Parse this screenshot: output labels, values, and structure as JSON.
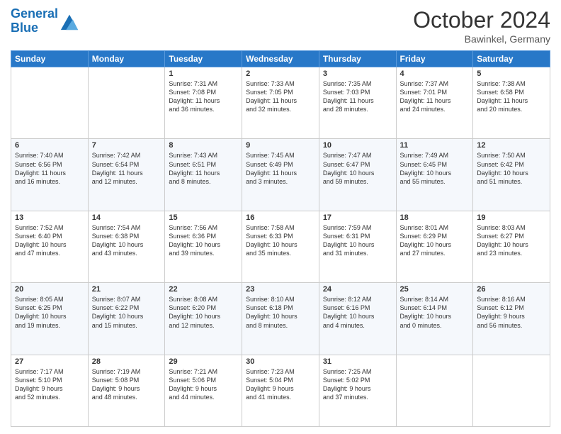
{
  "header": {
    "logo_line1": "General",
    "logo_line2": "Blue",
    "month_title": "October 2024",
    "location": "Bawinkel, Germany"
  },
  "weekdays": [
    "Sunday",
    "Monday",
    "Tuesday",
    "Wednesday",
    "Thursday",
    "Friday",
    "Saturday"
  ],
  "weeks": [
    [
      {
        "day": "",
        "info": ""
      },
      {
        "day": "",
        "info": ""
      },
      {
        "day": "1",
        "info": "Sunrise: 7:31 AM\nSunset: 7:08 PM\nDaylight: 11 hours\nand 36 minutes."
      },
      {
        "day": "2",
        "info": "Sunrise: 7:33 AM\nSunset: 7:05 PM\nDaylight: 11 hours\nand 32 minutes."
      },
      {
        "day": "3",
        "info": "Sunrise: 7:35 AM\nSunset: 7:03 PM\nDaylight: 11 hours\nand 28 minutes."
      },
      {
        "day": "4",
        "info": "Sunrise: 7:37 AM\nSunset: 7:01 PM\nDaylight: 11 hours\nand 24 minutes."
      },
      {
        "day": "5",
        "info": "Sunrise: 7:38 AM\nSunset: 6:58 PM\nDaylight: 11 hours\nand 20 minutes."
      }
    ],
    [
      {
        "day": "6",
        "info": "Sunrise: 7:40 AM\nSunset: 6:56 PM\nDaylight: 11 hours\nand 16 minutes."
      },
      {
        "day": "7",
        "info": "Sunrise: 7:42 AM\nSunset: 6:54 PM\nDaylight: 11 hours\nand 12 minutes."
      },
      {
        "day": "8",
        "info": "Sunrise: 7:43 AM\nSunset: 6:51 PM\nDaylight: 11 hours\nand 8 minutes."
      },
      {
        "day": "9",
        "info": "Sunrise: 7:45 AM\nSunset: 6:49 PM\nDaylight: 11 hours\nand 3 minutes."
      },
      {
        "day": "10",
        "info": "Sunrise: 7:47 AM\nSunset: 6:47 PM\nDaylight: 10 hours\nand 59 minutes."
      },
      {
        "day": "11",
        "info": "Sunrise: 7:49 AM\nSunset: 6:45 PM\nDaylight: 10 hours\nand 55 minutes."
      },
      {
        "day": "12",
        "info": "Sunrise: 7:50 AM\nSunset: 6:42 PM\nDaylight: 10 hours\nand 51 minutes."
      }
    ],
    [
      {
        "day": "13",
        "info": "Sunrise: 7:52 AM\nSunset: 6:40 PM\nDaylight: 10 hours\nand 47 minutes."
      },
      {
        "day": "14",
        "info": "Sunrise: 7:54 AM\nSunset: 6:38 PM\nDaylight: 10 hours\nand 43 minutes."
      },
      {
        "day": "15",
        "info": "Sunrise: 7:56 AM\nSunset: 6:36 PM\nDaylight: 10 hours\nand 39 minutes."
      },
      {
        "day": "16",
        "info": "Sunrise: 7:58 AM\nSunset: 6:33 PM\nDaylight: 10 hours\nand 35 minutes."
      },
      {
        "day": "17",
        "info": "Sunrise: 7:59 AM\nSunset: 6:31 PM\nDaylight: 10 hours\nand 31 minutes."
      },
      {
        "day": "18",
        "info": "Sunrise: 8:01 AM\nSunset: 6:29 PM\nDaylight: 10 hours\nand 27 minutes."
      },
      {
        "day": "19",
        "info": "Sunrise: 8:03 AM\nSunset: 6:27 PM\nDaylight: 10 hours\nand 23 minutes."
      }
    ],
    [
      {
        "day": "20",
        "info": "Sunrise: 8:05 AM\nSunset: 6:25 PM\nDaylight: 10 hours\nand 19 minutes."
      },
      {
        "day": "21",
        "info": "Sunrise: 8:07 AM\nSunset: 6:22 PM\nDaylight: 10 hours\nand 15 minutes."
      },
      {
        "day": "22",
        "info": "Sunrise: 8:08 AM\nSunset: 6:20 PM\nDaylight: 10 hours\nand 12 minutes."
      },
      {
        "day": "23",
        "info": "Sunrise: 8:10 AM\nSunset: 6:18 PM\nDaylight: 10 hours\nand 8 minutes."
      },
      {
        "day": "24",
        "info": "Sunrise: 8:12 AM\nSunset: 6:16 PM\nDaylight: 10 hours\nand 4 minutes."
      },
      {
        "day": "25",
        "info": "Sunrise: 8:14 AM\nSunset: 6:14 PM\nDaylight: 10 hours\nand 0 minutes."
      },
      {
        "day": "26",
        "info": "Sunrise: 8:16 AM\nSunset: 6:12 PM\nDaylight: 9 hours\nand 56 minutes."
      }
    ],
    [
      {
        "day": "27",
        "info": "Sunrise: 7:17 AM\nSunset: 5:10 PM\nDaylight: 9 hours\nand 52 minutes."
      },
      {
        "day": "28",
        "info": "Sunrise: 7:19 AM\nSunset: 5:08 PM\nDaylight: 9 hours\nand 48 minutes."
      },
      {
        "day": "29",
        "info": "Sunrise: 7:21 AM\nSunset: 5:06 PM\nDaylight: 9 hours\nand 44 minutes."
      },
      {
        "day": "30",
        "info": "Sunrise: 7:23 AM\nSunset: 5:04 PM\nDaylight: 9 hours\nand 41 minutes."
      },
      {
        "day": "31",
        "info": "Sunrise: 7:25 AM\nSunset: 5:02 PM\nDaylight: 9 hours\nand 37 minutes."
      },
      {
        "day": "",
        "info": ""
      },
      {
        "day": "",
        "info": ""
      }
    ]
  ]
}
